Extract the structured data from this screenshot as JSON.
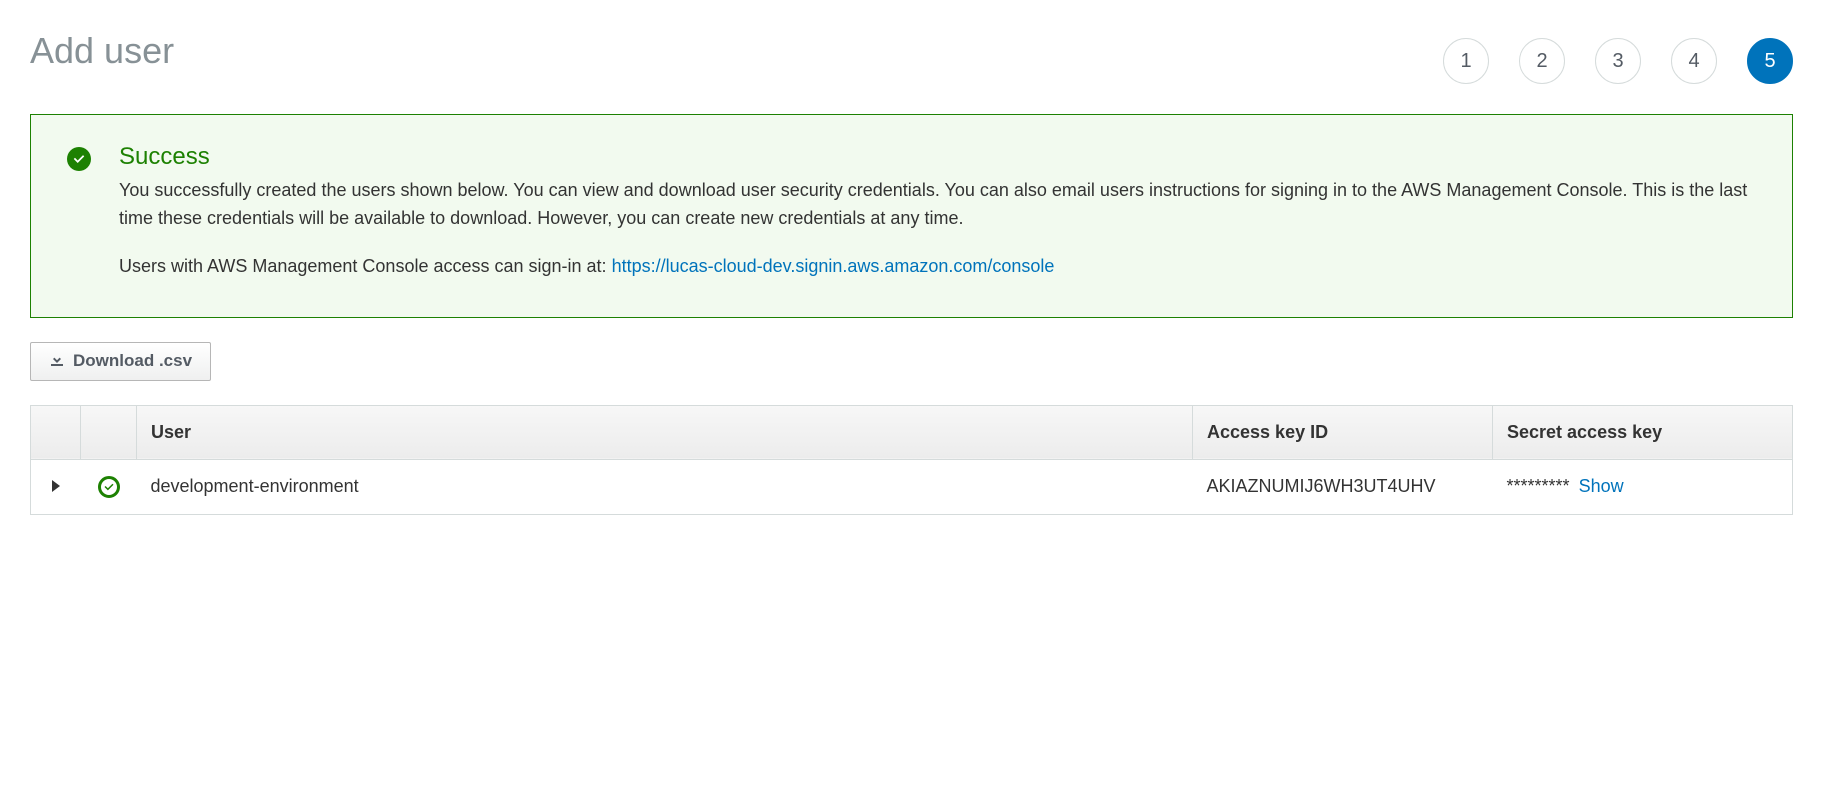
{
  "page": {
    "title": "Add user"
  },
  "stepper": {
    "steps": [
      "1",
      "2",
      "3",
      "4",
      "5"
    ],
    "current_index": 4
  },
  "alert": {
    "title": "Success",
    "message1": "You successfully created the users shown below. You can view and download user security credentials. You can also email users instructions for signing in to the AWS Management Console. This is the last time these credentials will be available to download. However, you can create new credentials at any time.",
    "message2_prefix": "Users with AWS Management Console access can sign-in at: ",
    "signin_url": "https://lucas-cloud-dev.signin.aws.amazon.com/console"
  },
  "actions": {
    "download_csv": "Download .csv"
  },
  "table": {
    "columns": {
      "user": "User",
      "access_key_id": "Access key ID",
      "secret_access_key": "Secret access key"
    },
    "rows": [
      {
        "user": "development-environment",
        "access_key_id": "AKIAZNUMIJ6WH3UT4UHV",
        "secret_masked": "*********",
        "show_label": "Show"
      }
    ]
  }
}
